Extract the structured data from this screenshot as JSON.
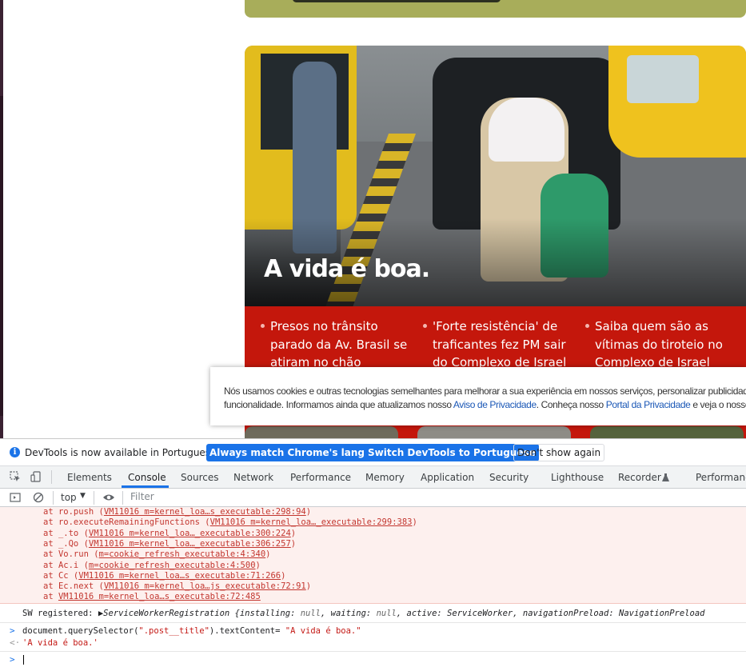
{
  "page": {
    "headline": "A vida é boa.",
    "stories": [
      "Presos no trânsito parado da Av. Brasil se atiram no chão",
      "'Forte resistência' de traficantes fez PM sair do Complexo de Israel",
      "Saiba quem são as vítimas do tiroteio no Complexo de Israel"
    ],
    "colors": {
      "accent": "#c4170c"
    }
  },
  "cookie": {
    "line1": "Nós usamos cookies e outras tecnologias semelhantes para melhorar a sua experiência em nossos serviços, personalizar publicidade",
    "line2_before": "funcionalidade. Informamos ainda que atualizamos nosso ",
    "privacy_notice": "Aviso de Privacidade",
    "line2_middle": ". Conheça nosso ",
    "privacy_portal": "Portal da Privacidade",
    "line2_after": " e veja o nosso"
  },
  "devtools": {
    "infobar": {
      "message": "DevTools is now available in Portuguese!",
      "match_button": "Always match Chrome's language",
      "switch_button": "Switch DevTools to Portuguese",
      "dismiss_button": "Don't show again"
    },
    "tabs": [
      "Elements",
      "Console",
      "Sources",
      "Network",
      "Performance",
      "Memory",
      "Application",
      "Security",
      "Lighthouse",
      "Recorder",
      "Performanc"
    ],
    "active_tab": "Console",
    "toolbar": {
      "context": "top",
      "filter_placeholder": "Filter"
    },
    "stack": [
      {
        "text": "at ro.push (",
        "link": "VM11016 m=kernel_loa…s_executable:298:94",
        "end": ")"
      },
      {
        "text": "at ro.executeRemainingFunctions (",
        "link": "VM11016 m=kernel_loa…_executable:299:383",
        "end": ")"
      },
      {
        "text": "at _.to (",
        "link": "VM11016 m=kernel_loa…_executable:300:224",
        "end": ")"
      },
      {
        "text": "at _.Qo (",
        "link": "VM11016 m=kernel_loa…_executable:306:257",
        "end": ")"
      },
      {
        "text": "at Vo.run (",
        "link": "m=cookie_refresh_executable:4:340",
        "end": ")"
      },
      {
        "text": "at Ac.i (",
        "link": "m=cookie_refresh_executable:4:500",
        "end": ")"
      },
      {
        "text": "at Cc (",
        "link": "VM11016 m=kernel_loa…s_executable:71:266",
        "end": ")"
      },
      {
        "text": "at Ec.next (",
        "link": "VM11016 m=kernel_loa…js_executable:72:91",
        "end": ")"
      },
      {
        "text": "at ",
        "link": "VM11016 m=kernel_loa…s_executable:72:485",
        "end": ""
      }
    ],
    "sw": {
      "label": "SW registered:",
      "arrow": "▶",
      "obj": "ServiceWorkerRegistration {installing: ",
      "v1": "null",
      "mid1": ", waiting: ",
      "v2": "null",
      "mid2": ", active: ServiceWorker, navigationPreload: NavigationPreload"
    },
    "command": {
      "prefix": "document.querySelector(",
      "selector": "\".post__title\"",
      "middle": ").textContent= ",
      "value": "\"A vida é boa.\""
    },
    "result": "'A vida é boa.'"
  }
}
